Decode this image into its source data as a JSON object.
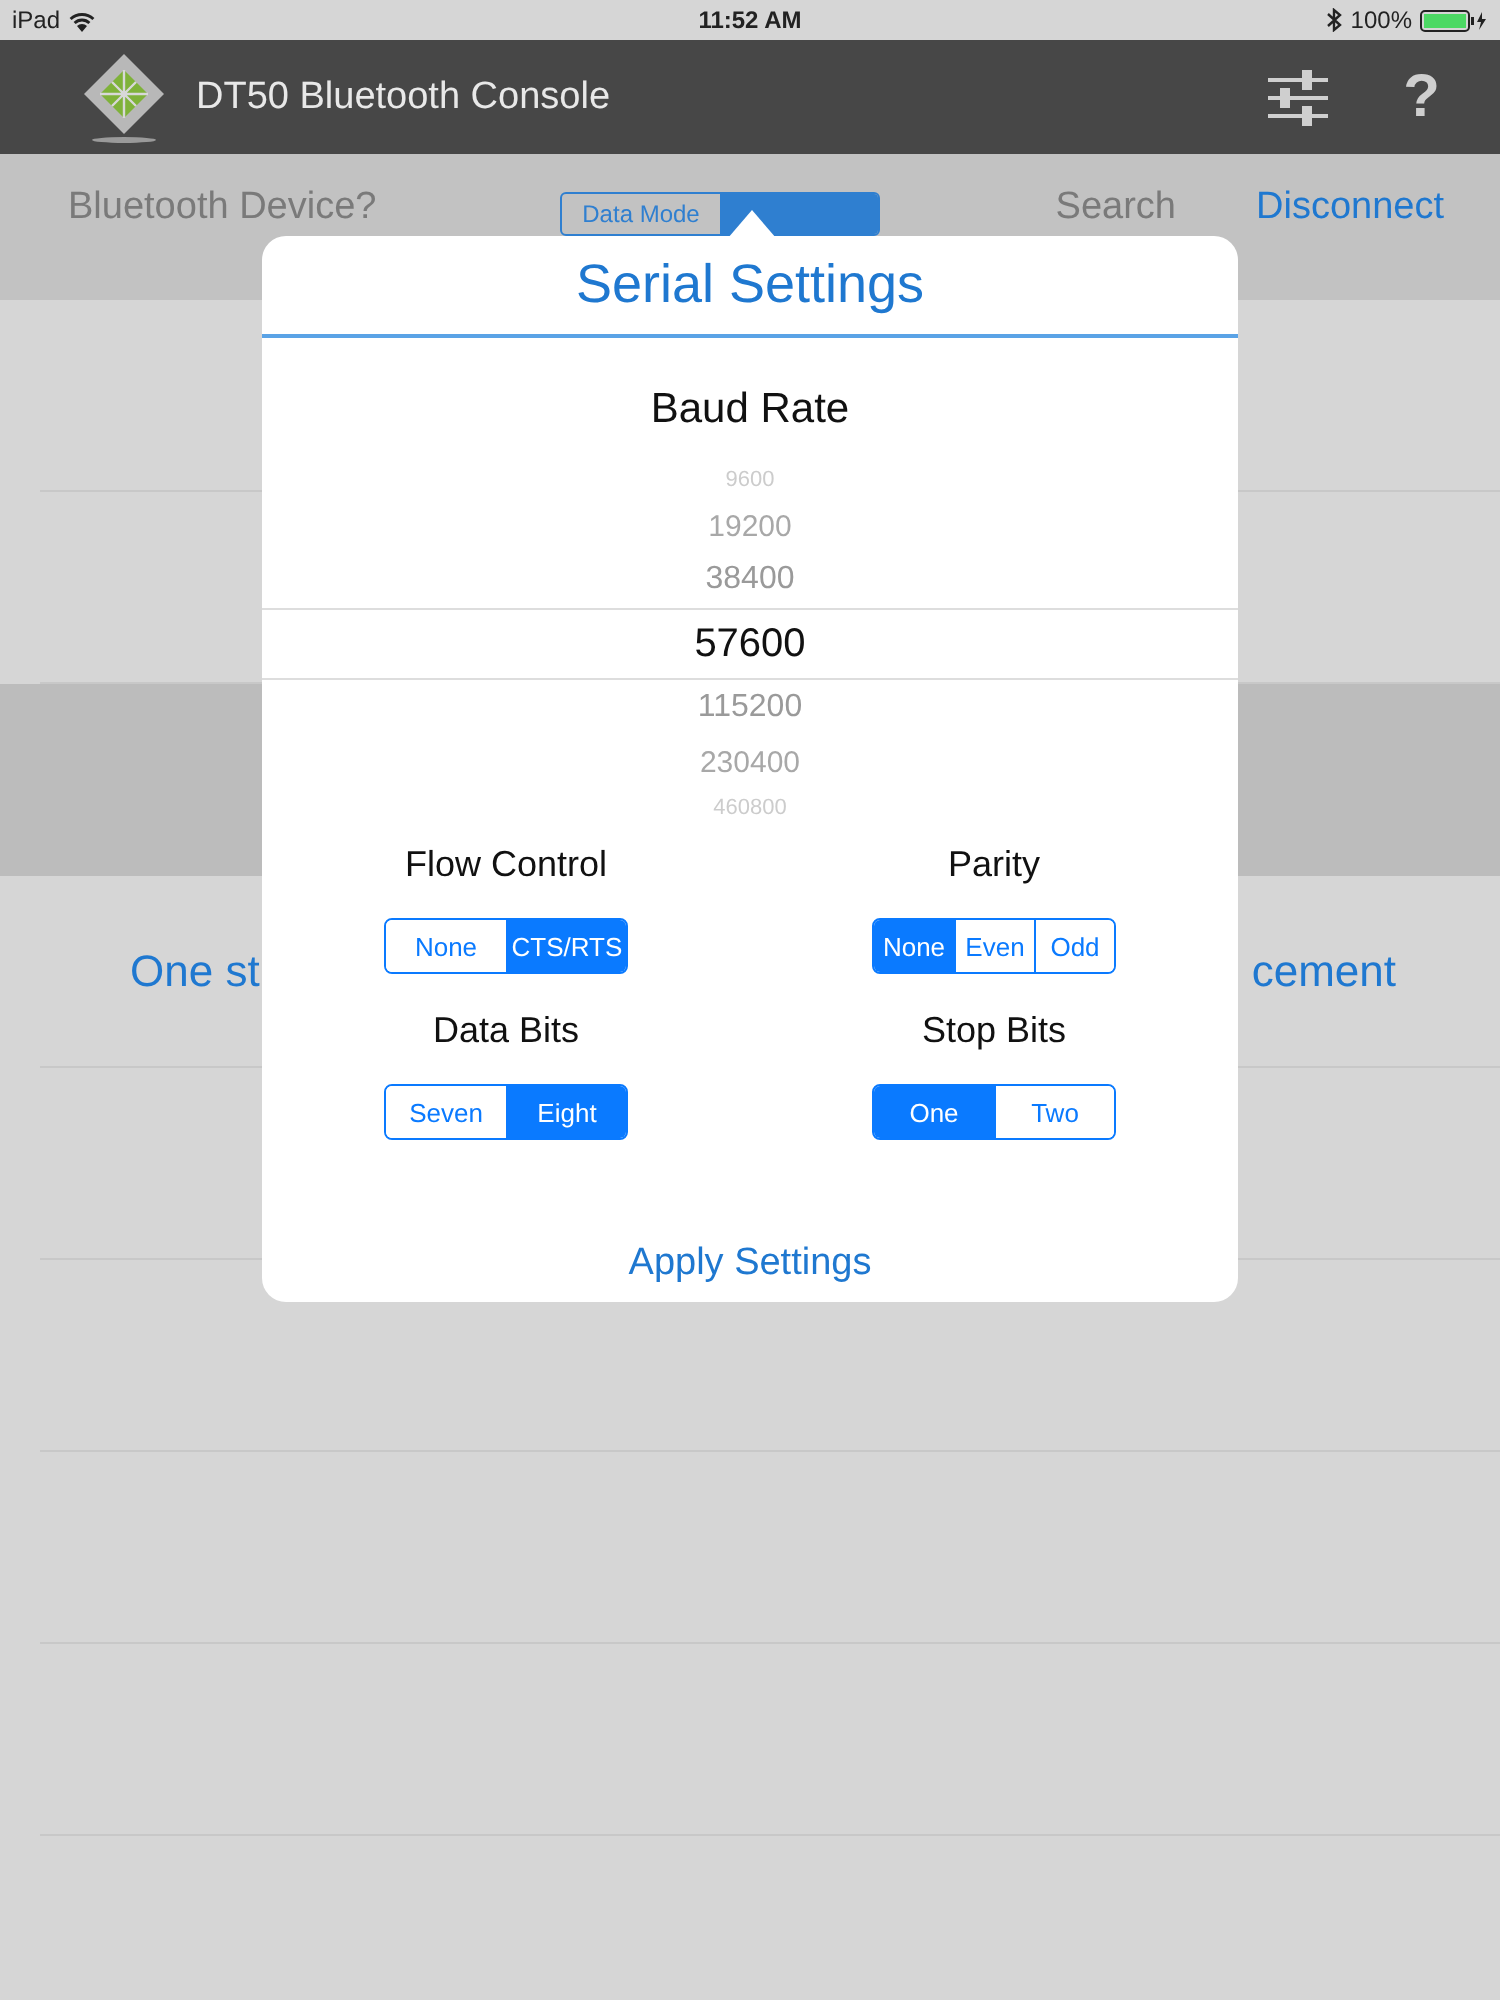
{
  "status_bar": {
    "device": "iPad",
    "time": "11:52 AM",
    "battery": "100%"
  },
  "nav_bar": {
    "title": "DT50 Bluetooth Console",
    "help": "?"
  },
  "toolbar": {
    "device_label": "Bluetooth Device?",
    "modes": [
      {
        "label": "Data Mode",
        "selected": false
      },
      {
        "selected": true
      }
    ],
    "search": "Search",
    "disconnect": "Disconnect"
  },
  "list": {
    "row_left": "One st",
    "row_right": "cement"
  },
  "popover": {
    "title": "Serial Settings",
    "baud_rate": {
      "label": "Baud Rate",
      "options": [
        {
          "label": "9600",
          "selected": false
        },
        {
          "label": "19200",
          "selected": false
        },
        {
          "label": "38400",
          "selected": false
        },
        {
          "label": "57600",
          "selected": true
        },
        {
          "label": "115200",
          "selected": false
        },
        {
          "label": "230400",
          "selected": false
        },
        {
          "label": "460800",
          "selected": false
        }
      ]
    },
    "groups": [
      {
        "label": "Flow Control",
        "options": [
          {
            "label": "None",
            "selected": false
          },
          {
            "label": "CTS/RTS",
            "selected": true
          }
        ]
      },
      {
        "label": "Parity",
        "options": [
          {
            "label": "None",
            "selected": true
          },
          {
            "label": "Even",
            "selected": false
          },
          {
            "label": "Odd",
            "selected": false
          }
        ]
      },
      {
        "label": "Data Bits",
        "options": [
          {
            "label": "Seven",
            "selected": false
          },
          {
            "label": "Eight",
            "selected": true
          }
        ]
      },
      {
        "label": "Stop Bits",
        "options": [
          {
            "label": "One",
            "selected": true
          },
          {
            "label": "Two",
            "selected": false
          }
        ]
      }
    ],
    "apply": "Apply Settings"
  }
}
